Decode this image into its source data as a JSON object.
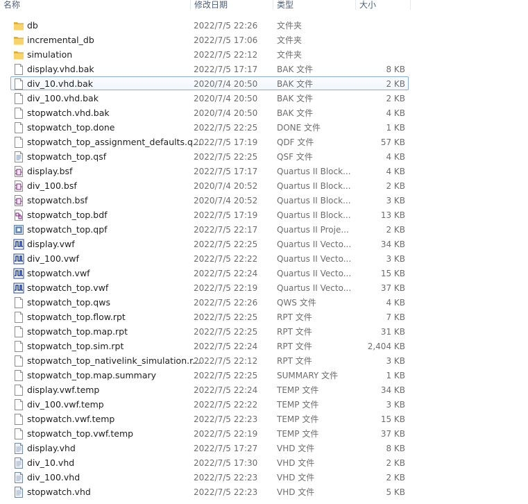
{
  "columns": {
    "name": "名称",
    "date": "修改日期",
    "type": "类型",
    "size": "大小"
  },
  "files": [
    {
      "name": "db",
      "date": "2022/7/5 22:26",
      "type": "文件夹",
      "size": "",
      "icon": "folder-icon"
    },
    {
      "name": "incremental_db",
      "date": "2022/7/5 17:06",
      "type": "文件夹",
      "size": "",
      "icon": "folder-icon"
    },
    {
      "name": "simulation",
      "date": "2022/7/5 22:12",
      "type": "文件夹",
      "size": "",
      "icon": "folder-icon"
    },
    {
      "name": "display.vhd.bak",
      "date": "2022/7/5 17:17",
      "type": "BAK 文件",
      "size": "8 KB",
      "icon": "file-icon"
    },
    {
      "name": "div_10.vhd.bak",
      "date": "2020/7/4 20:50",
      "type": "BAK 文件",
      "size": "2 KB",
      "icon": "file-icon",
      "selected": true
    },
    {
      "name": "div_100.vhd.bak",
      "date": "2020/7/4 20:50",
      "type": "BAK 文件",
      "size": "2 KB",
      "icon": "file-icon"
    },
    {
      "name": "stopwatch.vhd.bak",
      "date": "2020/7/4 20:50",
      "type": "BAK 文件",
      "size": "4 KB",
      "icon": "file-icon"
    },
    {
      "name": "stopwatch_top.done",
      "date": "2022/7/5 22:25",
      "type": "DONE 文件",
      "size": "1 KB",
      "icon": "file-icon"
    },
    {
      "name": "stopwatch_top_assignment_defaults.q...",
      "date": "2022/7/5 17:19",
      "type": "QDF 文件",
      "size": "57 KB",
      "icon": "file-icon"
    },
    {
      "name": "stopwatch_top.qsf",
      "date": "2022/7/5 22:25",
      "type": "QSF 文件",
      "size": "4 KB",
      "icon": "text-file-icon"
    },
    {
      "name": "display.bsf",
      "date": "2022/7/5 17:17",
      "type": "Quartus II Block...",
      "size": "4 KB",
      "icon": "block-symbol-icon"
    },
    {
      "name": "div_100.bsf",
      "date": "2020/7/4 20:52",
      "type": "Quartus II Block...",
      "size": "2 KB",
      "icon": "block-symbol-icon"
    },
    {
      "name": "stopwatch.bsf",
      "date": "2020/7/4 20:52",
      "type": "Quartus II Block...",
      "size": "3 KB",
      "icon": "block-symbol-icon"
    },
    {
      "name": "stopwatch_top.bdf",
      "date": "2022/7/5 17:19",
      "type": "Quartus II Block...",
      "size": "13 KB",
      "icon": "block-diagram-icon"
    },
    {
      "name": "stopwatch_top.qpf",
      "date": "2022/7/5 22:17",
      "type": "Quartus II Proje...",
      "size": "2 KB",
      "icon": "project-icon"
    },
    {
      "name": "display.vwf",
      "date": "2022/7/5 22:25",
      "type": "Quartus II Vecto...",
      "size": "34 KB",
      "icon": "waveform-icon"
    },
    {
      "name": "div_100.vwf",
      "date": "2022/7/5 22:22",
      "type": "Quartus II Vecto...",
      "size": "3 KB",
      "icon": "waveform-icon"
    },
    {
      "name": "stopwatch.vwf",
      "date": "2022/7/5 22:24",
      "type": "Quartus II Vecto...",
      "size": "15 KB",
      "icon": "waveform-icon"
    },
    {
      "name": "stopwatch_top.vwf",
      "date": "2022/7/5 22:19",
      "type": "Quartus II Vecto...",
      "size": "37 KB",
      "icon": "waveform-icon"
    },
    {
      "name": "stopwatch_top.qws",
      "date": "2022/7/5 22:26",
      "type": "QWS 文件",
      "size": "4 KB",
      "icon": "file-icon"
    },
    {
      "name": "stopwatch_top.flow.rpt",
      "date": "2022/7/5 22:25",
      "type": "RPT 文件",
      "size": "7 KB",
      "icon": "file-icon"
    },
    {
      "name": "stopwatch_top.map.rpt",
      "date": "2022/7/5 22:25",
      "type": "RPT 文件",
      "size": "31 KB",
      "icon": "file-icon"
    },
    {
      "name": "stopwatch_top.sim.rpt",
      "date": "2022/7/5 22:24",
      "type": "RPT 文件",
      "size": "2,404 KB",
      "icon": "file-icon"
    },
    {
      "name": "stopwatch_top_nativelink_simulation.r...",
      "date": "2022/7/5 22:12",
      "type": "RPT 文件",
      "size": "3 KB",
      "icon": "file-icon"
    },
    {
      "name": "stopwatch_top.map.summary",
      "date": "2022/7/5 22:25",
      "type": "SUMMARY 文件",
      "size": "1 KB",
      "icon": "file-icon"
    },
    {
      "name": "display.vwf.temp",
      "date": "2022/7/5 22:24",
      "type": "TEMP 文件",
      "size": "34 KB",
      "icon": "file-icon"
    },
    {
      "name": "div_100.vwf.temp",
      "date": "2022/7/5 22:22",
      "type": "TEMP 文件",
      "size": "3 KB",
      "icon": "file-icon"
    },
    {
      "name": "stopwatch.vwf.temp",
      "date": "2022/7/5 22:23",
      "type": "TEMP 文件",
      "size": "15 KB",
      "icon": "file-icon"
    },
    {
      "name": "stopwatch_top.vwf.temp",
      "date": "2022/7/5 22:19",
      "type": "TEMP 文件",
      "size": "37 KB",
      "icon": "file-icon"
    },
    {
      "name": "display.vhd",
      "date": "2022/7/5 17:27",
      "type": "VHD 文件",
      "size": "8 KB",
      "icon": "vhd-file-icon"
    },
    {
      "name": "div_10.vhd",
      "date": "2022/7/5 17:30",
      "type": "VHD 文件",
      "size": "2 KB",
      "icon": "vhd-file-icon"
    },
    {
      "name": "div_100.vhd",
      "date": "2022/7/5 22:23",
      "type": "VHD 文件",
      "size": "2 KB",
      "icon": "vhd-file-icon"
    },
    {
      "name": "stopwatch.vhd",
      "date": "2022/7/5 22:23",
      "type": "VHD 文件",
      "size": "5 KB",
      "icon": "vhd-file-icon"
    }
  ]
}
